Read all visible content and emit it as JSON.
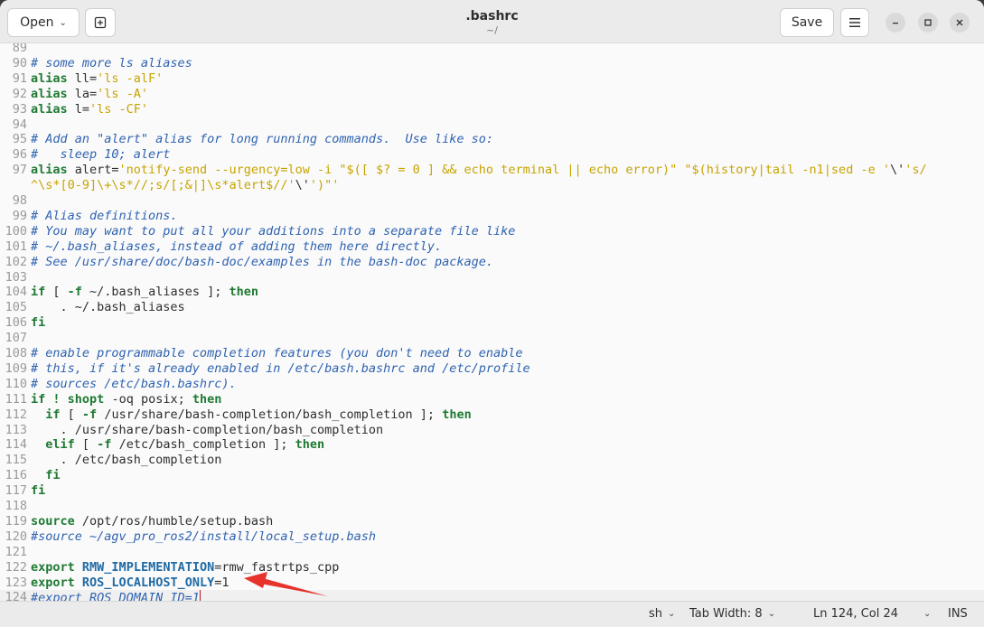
{
  "header": {
    "open_label": "Open",
    "save_label": "Save",
    "title": ".bashrc",
    "subtitle": "~/"
  },
  "lines": [
    {
      "n": "89",
      "segs": []
    },
    {
      "n": "90",
      "segs": [
        {
          "c": "cm",
          "t": "# some more ls aliases"
        }
      ]
    },
    {
      "n": "91",
      "segs": [
        {
          "c": "kw",
          "t": "alias"
        },
        {
          "c": "",
          "t": " ll="
        },
        {
          "c": "st",
          "t": "'ls -alF'"
        }
      ]
    },
    {
      "n": "92",
      "segs": [
        {
          "c": "kw",
          "t": "alias"
        },
        {
          "c": "",
          "t": " la="
        },
        {
          "c": "st",
          "t": "'ls -A'"
        }
      ]
    },
    {
      "n": "93",
      "segs": [
        {
          "c": "kw",
          "t": "alias"
        },
        {
          "c": "",
          "t": " l="
        },
        {
          "c": "st",
          "t": "'ls -CF'"
        }
      ]
    },
    {
      "n": "94",
      "segs": []
    },
    {
      "n": "95",
      "segs": [
        {
          "c": "cm",
          "t": "# Add an \"alert\" alias for long running commands.  Use like so:"
        }
      ]
    },
    {
      "n": "96",
      "segs": [
        {
          "c": "cm",
          "t": "#   sleep 10; alert"
        }
      ]
    },
    {
      "n": "97",
      "segs": [
        {
          "c": "kw",
          "t": "alias"
        },
        {
          "c": "",
          "t": " alert="
        },
        {
          "c": "st",
          "t": "'notify-send --urgency=low -i \"$([ $? = 0 ] && echo terminal || echo error)\" \"$(history|tail -n1|sed -e '"
        },
        {
          "c": "",
          "t": "\\'"
        },
        {
          "c": "st",
          "t": "'s/"
        }
      ]
    },
    {
      "n": "",
      "segs": [
        {
          "c": "st",
          "t": "^\\s*[0-9]\\+\\s*//;s/[;&|]\\s*alert$//'"
        },
        {
          "c": "",
          "t": "\\'"
        },
        {
          "c": "st",
          "t": "')\"'"
        }
      ]
    },
    {
      "n": "98",
      "segs": []
    },
    {
      "n": "99",
      "segs": [
        {
          "c": "cm",
          "t": "# Alias definitions."
        }
      ]
    },
    {
      "n": "100",
      "segs": [
        {
          "c": "cm",
          "t": "# You may want to put all your additions into a separate file like"
        }
      ]
    },
    {
      "n": "101",
      "segs": [
        {
          "c": "cm",
          "t": "# ~/.bash_aliases, instead of adding them here directly."
        }
      ]
    },
    {
      "n": "102",
      "segs": [
        {
          "c": "cm",
          "t": "# See /usr/share/doc/bash-doc/examples in the bash-doc package."
        }
      ]
    },
    {
      "n": "103",
      "segs": []
    },
    {
      "n": "104",
      "segs": [
        {
          "c": "kw",
          "t": "if"
        },
        {
          "c": "",
          "t": " [ "
        },
        {
          "c": "kw",
          "t": "-f"
        },
        {
          "c": "",
          "t": " ~/.bash_aliases ]; "
        },
        {
          "c": "kw",
          "t": "then"
        }
      ]
    },
    {
      "n": "105",
      "segs": [
        {
          "c": "",
          "t": "    . ~/.bash_aliases"
        }
      ]
    },
    {
      "n": "106",
      "segs": [
        {
          "c": "kw",
          "t": "fi"
        }
      ]
    },
    {
      "n": "107",
      "segs": []
    },
    {
      "n": "108",
      "segs": [
        {
          "c": "cm",
          "t": "# enable programmable completion features (you don't need to enable"
        }
      ]
    },
    {
      "n": "109",
      "segs": [
        {
          "c": "cm",
          "t": "# this, if it's already enabled in /etc/bash.bashrc and /etc/profile"
        }
      ]
    },
    {
      "n": "110",
      "segs": [
        {
          "c": "cm",
          "t": "# sources /etc/bash.bashrc)."
        }
      ]
    },
    {
      "n": "111",
      "segs": [
        {
          "c": "kw",
          "t": "if"
        },
        {
          "c": "",
          "t": " "
        },
        {
          "c": "kw",
          "t": "! shopt"
        },
        {
          "c": "",
          "t": " -oq posix; "
        },
        {
          "c": "kw",
          "t": "then"
        }
      ]
    },
    {
      "n": "112",
      "segs": [
        {
          "c": "",
          "t": "  "
        },
        {
          "c": "kw",
          "t": "if"
        },
        {
          "c": "",
          "t": " [ "
        },
        {
          "c": "kw",
          "t": "-f"
        },
        {
          "c": "",
          "t": " /usr/share/bash-completion/bash_completion ]; "
        },
        {
          "c": "kw",
          "t": "then"
        }
      ]
    },
    {
      "n": "113",
      "segs": [
        {
          "c": "",
          "t": "    . /usr/share/bash-completion/bash_completion"
        }
      ]
    },
    {
      "n": "114",
      "segs": [
        {
          "c": "",
          "t": "  "
        },
        {
          "c": "kw",
          "t": "elif"
        },
        {
          "c": "",
          "t": " [ "
        },
        {
          "c": "kw",
          "t": "-f"
        },
        {
          "c": "",
          "t": " /etc/bash_completion ]; "
        },
        {
          "c": "kw",
          "t": "then"
        }
      ]
    },
    {
      "n": "115",
      "segs": [
        {
          "c": "",
          "t": "    . /etc/bash_completion"
        }
      ]
    },
    {
      "n": "116",
      "segs": [
        {
          "c": "",
          "t": "  "
        },
        {
          "c": "kw",
          "t": "fi"
        }
      ]
    },
    {
      "n": "117",
      "segs": [
        {
          "c": "kw",
          "t": "fi"
        }
      ]
    },
    {
      "n": "118",
      "segs": []
    },
    {
      "n": "119",
      "segs": [
        {
          "c": "kw",
          "t": "source"
        },
        {
          "c": "",
          "t": " /opt/ros/humble/setup.bash"
        }
      ]
    },
    {
      "n": "120",
      "segs": [
        {
          "c": "cm",
          "t": "#source ~/agv_pro_ros2/install/local_setup.bash"
        }
      ]
    },
    {
      "n": "121",
      "segs": []
    },
    {
      "n": "122",
      "segs": [
        {
          "c": "kw",
          "t": "export"
        },
        {
          "c": "",
          "t": " "
        },
        {
          "c": "vr",
          "t": "RMW_IMPLEMENTATION"
        },
        {
          "c": "",
          "t": "=rmw_fastrtps_cpp"
        }
      ]
    },
    {
      "n": "123",
      "segs": [
        {
          "c": "kw",
          "t": "export"
        },
        {
          "c": "",
          "t": " "
        },
        {
          "c": "vr",
          "t": "ROS_LOCALHOST_ONLY"
        },
        {
          "c": "",
          "t": "=1"
        }
      ]
    },
    {
      "n": "124",
      "segs": [
        {
          "c": "cm",
          "t": "#export ROS_DOMAIN_ID=1"
        }
      ],
      "current": true
    }
  ],
  "status": {
    "language": "sh",
    "tab_width": "Tab Width: 8",
    "position": "Ln 124, Col 24",
    "mode": "INS"
  },
  "annotation_color": "#e8322c"
}
